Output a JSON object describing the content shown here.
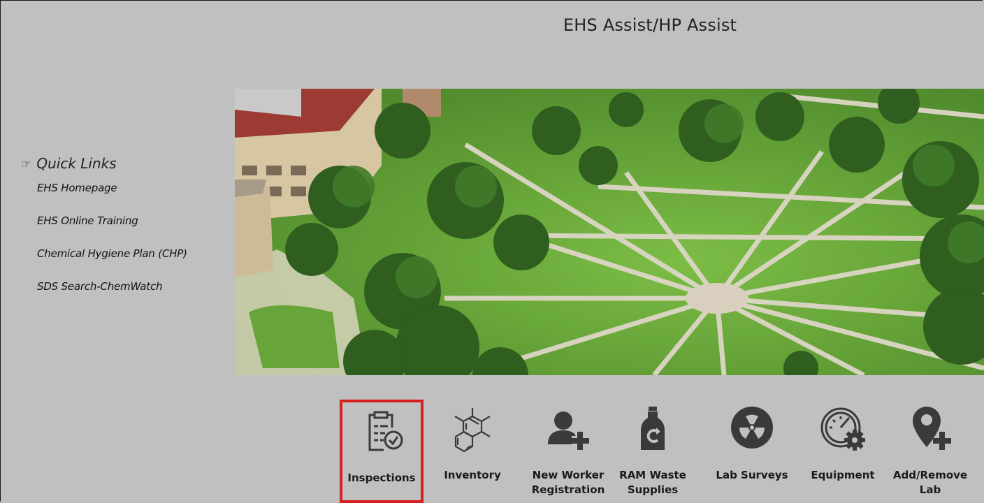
{
  "page": {
    "title": "EHS Assist/HP Assist"
  },
  "quick_links": {
    "icon": "pointing-hand-icon",
    "title": "Quick Links",
    "items": [
      {
        "label": "EHS Homepage"
      },
      {
        "label": "EHS Online Training"
      },
      {
        "label": "Chemical Hygiene Plan (CHP)"
      },
      {
        "label": "SDS Search-ChemWatch"
      }
    ]
  },
  "hero": {
    "description_icon": "campus-aerial-photo"
  },
  "tools": [
    {
      "label_1": "Inspections",
      "label_2": "",
      "icon": "clipboard-check-icon",
      "selected": true
    },
    {
      "label_1": "Inventory",
      "label_2": "",
      "icon": "molecule-icon",
      "selected": false
    },
    {
      "label_1": "New Worker",
      "label_2": "Registration",
      "icon": "add-user-icon",
      "selected": false
    },
    {
      "label_1": "RAM Waste",
      "label_2": "Supplies",
      "icon": "waste-jug-icon",
      "selected": false
    },
    {
      "label_1": "Lab Surveys",
      "label_2": "",
      "icon": "radiation-icon",
      "selected": false
    },
    {
      "label_1": "Equipment",
      "label_2": "",
      "icon": "gauge-gear-icon",
      "selected": false
    },
    {
      "label_1": "Add/Remove",
      "label_2": "Lab",
      "icon": "add-location-icon",
      "selected": false
    }
  ],
  "colors": {
    "background": "#c0c0c0",
    "selection_border": "#d62020",
    "icon": "#3a3a3a"
  }
}
